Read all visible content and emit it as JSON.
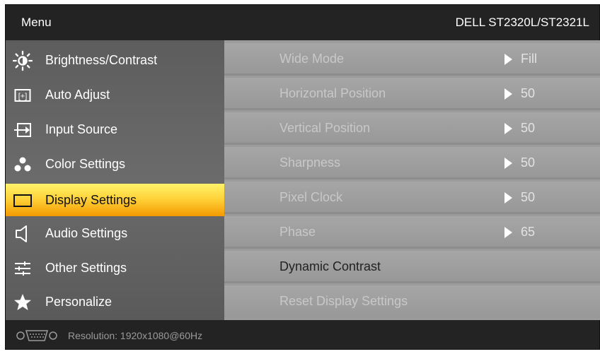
{
  "header": {
    "menu_label": "Menu",
    "model": "DELL  ST2320L/ST2321L"
  },
  "menu": {
    "items": [
      {
        "label": "Brightness/Contrast",
        "icon": "brightness-icon"
      },
      {
        "label": "Auto Adjust",
        "icon": "auto-adjust-icon"
      },
      {
        "label": "Input Source",
        "icon": "input-source-icon"
      },
      {
        "label": "Color Settings",
        "icon": "color-settings-icon"
      },
      {
        "label": "Display Settings",
        "icon": "display-settings-icon",
        "selected": true
      },
      {
        "label": "Audio Settings",
        "icon": "speaker-icon"
      },
      {
        "label": "Other Settings",
        "icon": "sliders-icon"
      },
      {
        "label": "Personalize",
        "icon": "star-icon"
      }
    ]
  },
  "settings": {
    "rows": [
      {
        "label": "Wide Mode",
        "value": "Fill"
      },
      {
        "label": "Horizontal Position",
        "value": "50"
      },
      {
        "label": "Vertical Position",
        "value": "50"
      },
      {
        "label": "Sharpness",
        "value": "50"
      },
      {
        "label": "Pixel Clock",
        "value": "50"
      },
      {
        "label": "Phase",
        "value": "65"
      },
      {
        "label": "Dynamic Contrast"
      },
      {
        "label": "Reset Display Settings"
      }
    ]
  },
  "footer": {
    "resolution": "Resolution:  1920x1080@60Hz",
    "connector_icon": "vga-connector-icon"
  },
  "colors": {
    "selected_top": "#fff36a",
    "selected_bottom": "#f49a00",
    "panel_bg": "#232323"
  }
}
